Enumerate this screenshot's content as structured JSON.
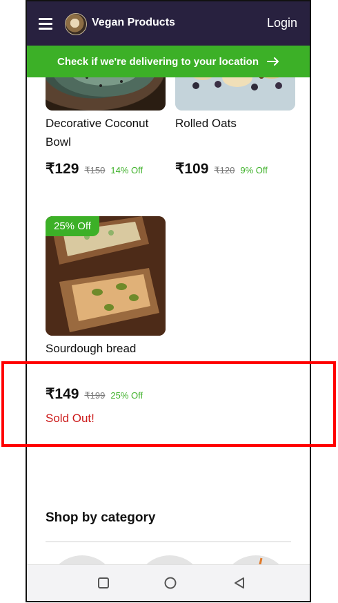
{
  "header": {
    "title": "Vegan Products",
    "login_label": "Login"
  },
  "banner": {
    "text": "Check if we're delivering to your location"
  },
  "products": [
    {
      "name": "Decorative Coconut Bowl",
      "price": "₹129",
      "mrp": "₹150",
      "discount": "14% Off"
    },
    {
      "name": "Rolled Oats",
      "price": "₹109",
      "mrp": "₹120",
      "discount": "9% Off"
    },
    {
      "name": "Sourdough bread",
      "badge": "25% Off",
      "price": "₹149",
      "mrp": "₹199",
      "discount": "25% Off",
      "status": "Sold Out!"
    }
  ],
  "category_section": {
    "title": "Shop by category"
  },
  "colors": {
    "header_bg": "#28213f",
    "accent_green": "#3cb027",
    "sold_out_red": "#cc1a1a",
    "highlight": "#ff0000"
  }
}
